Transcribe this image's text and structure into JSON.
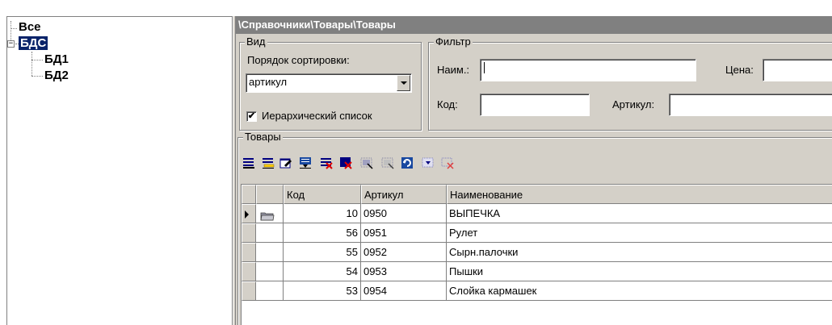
{
  "tree": {
    "items": [
      {
        "label": "Все"
      },
      {
        "label": "БДС",
        "expander": "−"
      },
      {
        "label": "БД1"
      },
      {
        "label": "БД2"
      }
    ]
  },
  "path_title": "\\Справочники\\Товары\\Товары",
  "view_group": {
    "caption": "Вид",
    "sort_label": "Порядок сортировки:",
    "sort_value": "артикул",
    "hier_checked": "✔",
    "hier_label": "Иерархический список"
  },
  "filter_group": {
    "caption": "Фильтр",
    "name_label": "Наим.:",
    "name_value": "",
    "price_label": "Цена:",
    "price_value": "",
    "code_label": "Код:",
    "code_value": "",
    "article_label": "Артикул:",
    "article_value": ""
  },
  "goods_group": {
    "caption": "Товары",
    "toolbar_icons": [
      "insert-record-icon",
      "insert-child-icon",
      "edit-record-icon",
      "move-record-icon",
      "delete-record-icon",
      "delete-all-icon",
      "select-icon",
      "deselect-icon",
      "refresh-icon",
      "mark-icon",
      "unmark-icon"
    ]
  },
  "grid": {
    "columns": [
      "",
      "Код",
      "Артикул",
      "Наименование"
    ],
    "rows": [
      {
        "code": "10",
        "article": "0950",
        "name": "ВЫПЕЧКА",
        "folder": true,
        "current": true
      },
      {
        "code": "56",
        "article": "0951",
        "name": "Рулет"
      },
      {
        "code": "55",
        "article": "0952",
        "name": "Сырн.палочки"
      },
      {
        "code": "54",
        "article": "0953",
        "name": "Пышки"
      },
      {
        "code": "53",
        "article": "0954",
        "name": "Слойка кармашек"
      }
    ]
  },
  "colors": {
    "selection": "#0a246a",
    "panel": "#d4d0c8",
    "title_bar": "#808080"
  }
}
